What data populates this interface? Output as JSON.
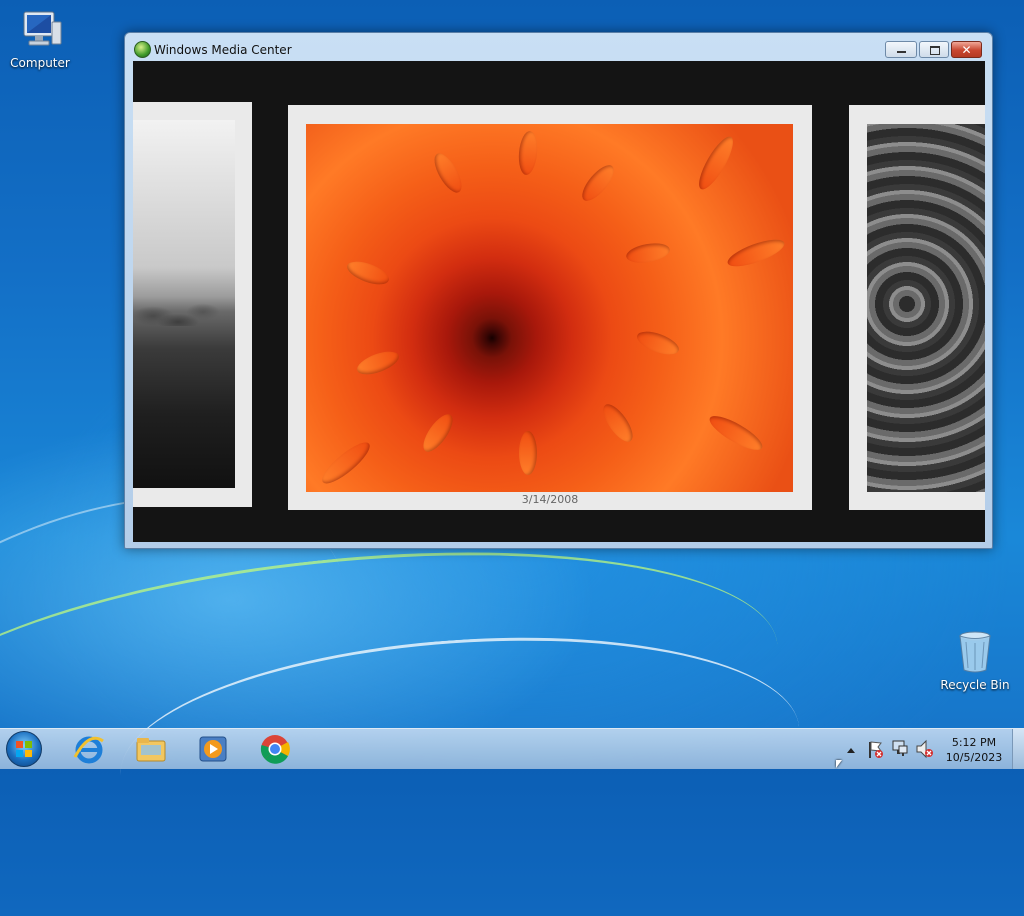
{
  "desktop": {
    "icons": [
      {
        "label": "Computer",
        "icon": "computer-icon"
      },
      {
        "label": "Recycle Bin",
        "icon": "recycle-bin-icon"
      }
    ]
  },
  "window": {
    "title": "Windows Media Center",
    "app_icon": "windows-media-center-icon",
    "controls": {
      "minimize": "minimize-icon",
      "maximize": "maximize-icon",
      "close": "close-icon"
    },
    "slideshow": {
      "current_date": "3/14/2008",
      "photos": [
        {
          "position": "previous",
          "subject": "grayscale landscape"
        },
        {
          "position": "current",
          "subject": "orange chrysanthemum"
        },
        {
          "position": "next",
          "subject": "grayscale flower"
        }
      ]
    }
  },
  "taskbar": {
    "start": "windows-start-icon",
    "pinned": [
      "internet-explorer-icon",
      "windows-explorer-icon",
      "windows-media-player-icon",
      "chrome-icon"
    ],
    "tray": {
      "icons": [
        "show-hidden-icons-icon",
        "action-center-icon",
        "network-icon",
        "volume-muted-icon"
      ],
      "time": "5:12 PM",
      "date": "10/5/2023"
    }
  },
  "colors": {
    "accent": "#1a88d8",
    "close_button": "#c84630",
    "frame": "#eaeaea",
    "viewport": "#141414"
  }
}
